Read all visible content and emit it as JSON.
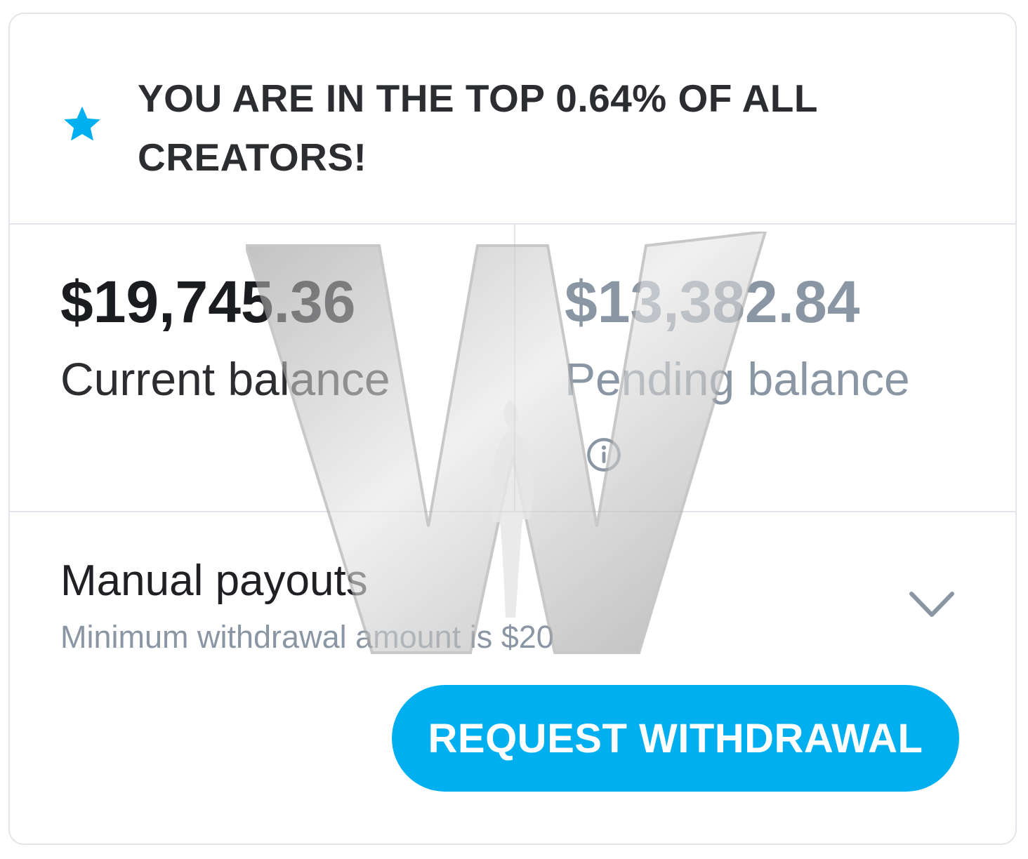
{
  "banner": {
    "icon": "star-icon",
    "text": "YOU ARE IN THE TOP 0.64% OF ALL CREATORS!"
  },
  "balances": {
    "current_amount": "$19,745.36",
    "current_label": "Current balance",
    "pending_amount": "$13,382.84",
    "pending_label": "Pending balance",
    "pending_info_icon": "info-icon"
  },
  "payouts": {
    "title": "Manual payouts",
    "subtitle": "Minimum withdrawal amount is $20",
    "toggle_icon": "chevron-down-icon"
  },
  "actions": {
    "withdraw_label": "REQUEST WITHDRAWAL"
  },
  "colors": {
    "accent": "#00aff0",
    "muted_text": "#8a96a3",
    "primary_text": "#1b1c1f",
    "border": "#e3e5ea"
  },
  "watermark": {
    "icon": "w-logo-watermark"
  }
}
